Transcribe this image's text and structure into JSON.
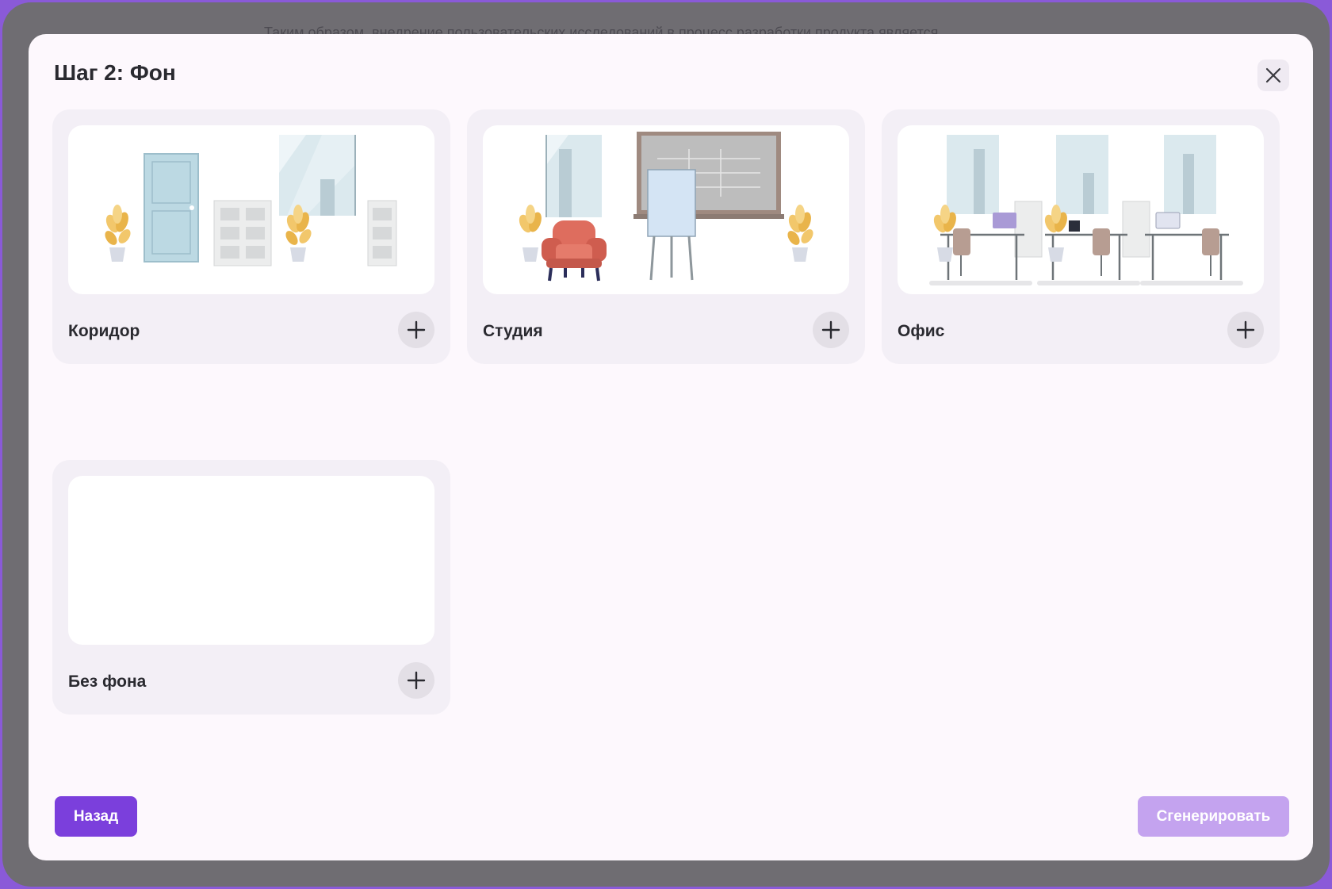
{
  "background": {
    "text": "Таким образом, внедрение пользовательских исследований в процесс разработки продукта является"
  },
  "modal": {
    "title": "Шаг 2: Фон"
  },
  "cards": [
    {
      "label": "Коридор",
      "image": "corridor-illustration"
    },
    {
      "label": "Студия",
      "image": "studio-illustration"
    },
    {
      "label": "Офис",
      "image": "office-illustration"
    },
    {
      "label": "Без фона",
      "image": "empty"
    }
  ],
  "footer": {
    "back_label": "Назад",
    "generate_label": "Сгенерировать"
  },
  "colors": {
    "accent": "#7b3fdc",
    "accent_disabled": "#c4a3ef",
    "card_bg": "#f3eff6",
    "modal_bg": "#fdf8fd"
  },
  "icons": {
    "close": "close-icon",
    "add": "plus-icon"
  }
}
